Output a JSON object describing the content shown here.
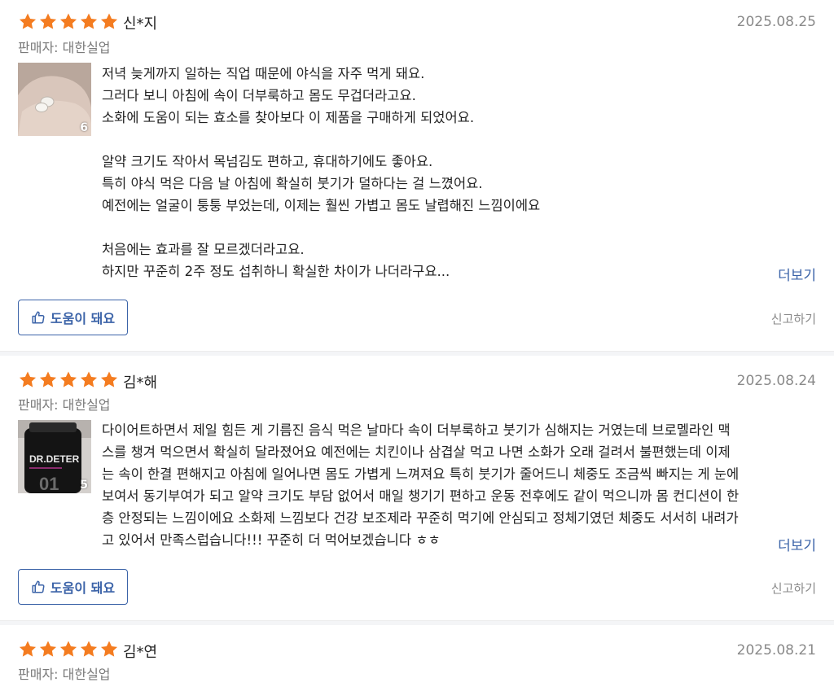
{
  "reviews": [
    {
      "rating": 5,
      "name": "신*지",
      "date": "2025.08.25",
      "seller": "판매자: 대한실업",
      "photo_count": "6",
      "body": "저녁 늦게까지 일하는 직업 때문에 야식을 자주 먹게 돼요.\n그러다 보니 아침에 속이 더부룩하고 몸도 무겁더라고요.\n소화에 도움이 되는 효소를 찾아보다 이 제품을 구매하게 되었어요.\n\n알약 크기도 작아서 목넘김도 편하고, 휴대하기에도 좋아요.\n특히 야식 먹은 다음 날 아침에 확실히 붓기가 덜하다는 걸 느꼈어요.\n예전에는 얼굴이 퉁퉁 부었는데, 이제는 훨씬 가볍고 몸도 날렵해진 느낌이에요\n\n처음에는 효과를 잘 모르겠더라고요.\n하지만 꾸준히 2주 정도 섭취하니 확실한 차이가 나더라구요...",
      "more_label": "더보기",
      "helpful_label": "도움이 돼요",
      "report_label": "신고하기"
    },
    {
      "rating": 5,
      "name": "김*해",
      "date": "2025.08.24",
      "seller": "판매자: 대한실업",
      "photo_count": "5",
      "photo_text": "DR.DETER",
      "body": "다이어트하면서 제일 힘든 게 기름진 음식 먹은 날마다 속이 더부룩하고 붓기가 심해지는 거였는데 브로멜라인 맥\n스를 챙겨 먹으면서 확실히 달라졌어요 예전에는 치킨이나 삼겹살 먹고 나면 소화가 오래 걸려서 불편했는데 이제\n는 속이 한결 편해지고 아침에 일어나면 몸도 가볍게 느껴져요 특히 붓기가 줄어드니 체중도 조금씩 빠지는 게 눈에\n보여서 동기부여가 되고 알약 크기도 부담 없어서 매일 챙기기 편하고 운동 전후에도 같이 먹으니까 몸 컨디션이 한\n층 안정되는 느낌이에요 소화제 느낌보다 건강 보조제라 꾸준히 먹기에 안심되고 정체기였던 체중도 서서히 내려가\n고 있어서 만족스럽습니다!!! 꾸준히 더 먹어보겠습니다 ㅎㅎ",
      "more_label": "더보기",
      "helpful_label": "도움이 돼요",
      "report_label": "신고하기"
    },
    {
      "rating": 5,
      "name": "김*연",
      "date": "2025.08.21",
      "seller": "판매자: 대한실업"
    }
  ],
  "colors": {
    "star": "#f47c20",
    "accent": "#3b63a8",
    "muted": "#8a8a8a"
  }
}
